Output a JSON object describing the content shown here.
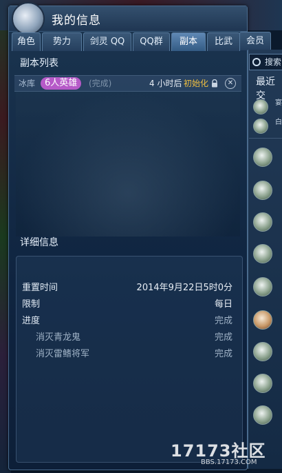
{
  "window": {
    "title": "我的信息"
  },
  "tabs": [
    {
      "label": "角色",
      "active": false
    },
    {
      "label": "势力",
      "active": false
    },
    {
      "label": "剑灵 QQ",
      "active": false
    },
    {
      "label": "QQ群",
      "active": false
    },
    {
      "label": "副本",
      "active": true
    },
    {
      "label": "比武",
      "active": false
    },
    {
      "label": "会员",
      "active": false
    }
  ],
  "dungeon_list": {
    "title": "副本列表",
    "rows": [
      {
        "name": "冰库",
        "mode": "6人英雄",
        "status": "(完成)",
        "reset_time": "4 小时后",
        "reset_action": "初始化",
        "mode_color": "#b65ac8"
      }
    ]
  },
  "detail": {
    "title": "详细信息",
    "rows": [
      {
        "label": "重置时间",
        "value": "2014年9月22日5时0分"
      },
      {
        "label": "限制",
        "value": "每日"
      },
      {
        "label": "进度",
        "value": "完成"
      },
      {
        "label": "消灭青龙鬼",
        "value": "完成"
      },
      {
        "label": "消灭雷鳍将军",
        "value": "完成"
      }
    ]
  },
  "side": {
    "search_label": "搜索",
    "recent_label": "最近交",
    "contacts": [
      {
        "name": "宴"
      },
      {
        "name": "白"
      },
      {
        "name": ""
      },
      {
        "name": ""
      },
      {
        "name": ""
      },
      {
        "name": ""
      },
      {
        "name": ""
      },
      {
        "name": ""
      },
      {
        "name": ""
      },
      {
        "name": ""
      },
      {
        "name": ""
      }
    ]
  },
  "watermark": {
    "brand": "17173社区",
    "url": "BBS.17173.COM"
  }
}
